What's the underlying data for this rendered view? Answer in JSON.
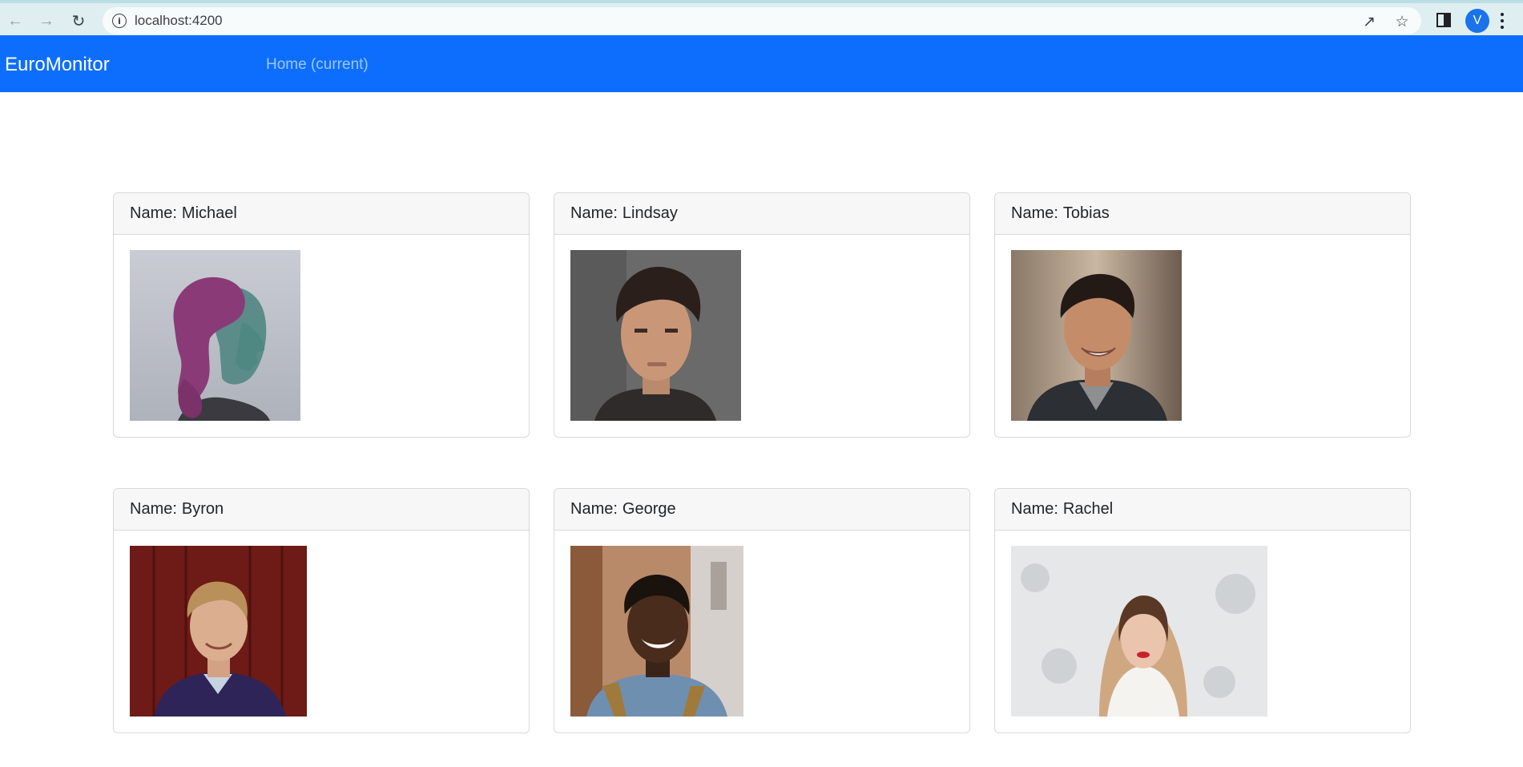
{
  "browser": {
    "url": "localhost:4200",
    "profile_initial": "V",
    "icons": [
      "back-icon",
      "forward-icon",
      "reload-icon",
      "site-info-icon",
      "share-icon",
      "bookmark-star-icon",
      "side-panel-icon",
      "menu-icon"
    ]
  },
  "navbar": {
    "brand": "EuroMonitor",
    "links": [
      {
        "label": "Home (current)"
      }
    ],
    "background_color": "#0d6efd"
  },
  "cards": {
    "name_label": "Name:",
    "items": [
      {
        "name": "Michael",
        "photo": "portrait-woman-teal-magenta-lighting"
      },
      {
        "name": "Lindsay",
        "photo": "portrait-young-man-grey-background"
      },
      {
        "name": "Tobias",
        "photo": "portrait-smiling-man-outdoors"
      },
      {
        "name": "Byron",
        "photo": "portrait-man-red-wall"
      },
      {
        "name": "George",
        "photo": "portrait-smiling-man-street"
      },
      {
        "name": "Rachel",
        "photo": "portrait-woman-snow-hood"
      }
    ]
  }
}
